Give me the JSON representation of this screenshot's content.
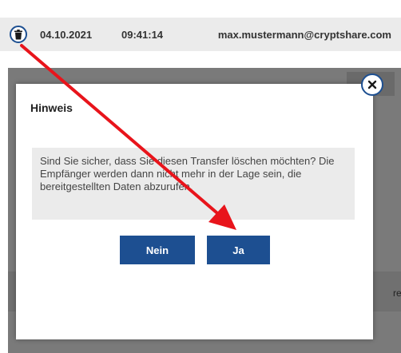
{
  "transfer": {
    "date": "04.10.2021",
    "time": "09:41:14",
    "email": "max.mustermann@cryptshare.com"
  },
  "dialog": {
    "title": "Hinweis",
    "message": "Sind Sie sicher, dass Sie diesen Transfer löschen möchten? Die Empfänger werden dann nicht mehr in der Lage sein, die bereitgestellten Daten abzurufen.",
    "no_label": "Nein",
    "yes_label": "Ja"
  },
  "background": {
    "edge_text": "re"
  },
  "colors": {
    "accent": "#1d4f91",
    "annotation_arrow": "#e8141b",
    "overlay": "#7a7a7a"
  },
  "icons": {
    "delete": "trash-icon",
    "close": "close-icon"
  }
}
